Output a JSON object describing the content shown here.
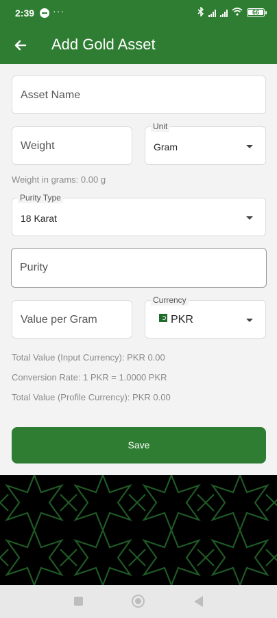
{
  "status_bar": {
    "time": "2:39",
    "battery": "66"
  },
  "app_bar": {
    "title": "Add Gold Asset"
  },
  "form": {
    "asset_name_placeholder": "Asset Name",
    "weight_placeholder": "Weight",
    "unit_label": "Unit",
    "unit_value": "Gram",
    "weight_hint": "Weight in grams: 0.00 g",
    "purity_type_label": "Purity Type",
    "purity_type_value": "18 Karat",
    "purity_placeholder": "Purity",
    "value_per_gram_placeholder": "Value per Gram",
    "currency_label": "Currency",
    "currency_flag": "🇵🇰",
    "currency_value": "PKR",
    "total_input": "Total Value (Input Currency): PKR 0.00",
    "conversion_rate": "Conversion Rate: 1 PKR = 1.0000 PKR",
    "total_profile": "Total Value (Profile Currency): PKR 0.00",
    "save_label": "Save"
  },
  "colors": {
    "primary": "#2e7d32",
    "background": "#f3f3f3",
    "pattern": "#1b4d20"
  },
  "icons": [
    "back-arrow-icon",
    "dropdown-caret-icon",
    "wifi-icon",
    "bluetooth-icon",
    "battery-icon",
    "square-icon",
    "circle-icon",
    "triangle-back-icon"
  ]
}
